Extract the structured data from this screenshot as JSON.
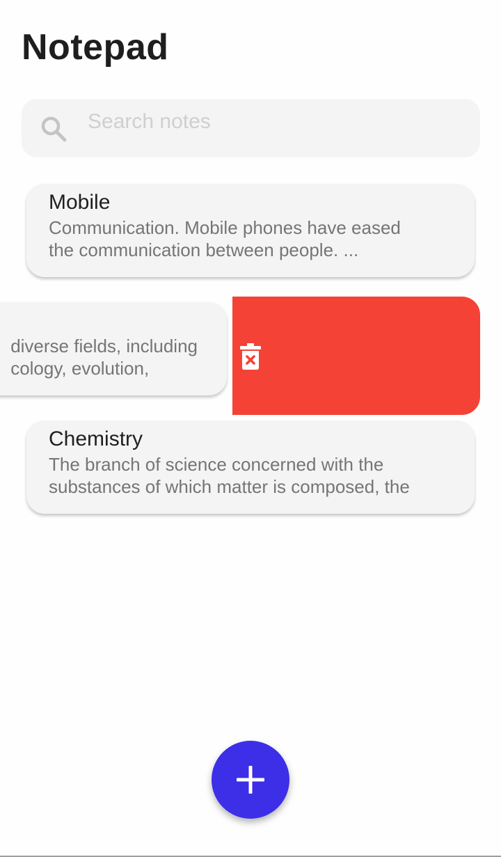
{
  "app": {
    "title": "Notepad"
  },
  "search": {
    "placeholder": "Search notes",
    "value": "",
    "icon": "search-icon"
  },
  "notes": [
    {
      "title": "Mobile",
      "snippet_lines": [
        "Communication. Mobile phones have eased",
        "the communication between people. ..."
      ]
    },
    {
      "title": "",
      "swiped": true,
      "snippet_lines": [
        "diverse fields, including",
        "cology, evolution,"
      ]
    },
    {
      "title": "Chemistry",
      "snippet_lines": [
        "The branch of science concerned with the",
        "substances of which matter is composed, the"
      ]
    }
  ],
  "delete_action": {
    "icon": "trash-delete-icon",
    "color": "#f44336"
  },
  "fab": {
    "icon": "plus-icon",
    "color": "#3d2ee8"
  }
}
